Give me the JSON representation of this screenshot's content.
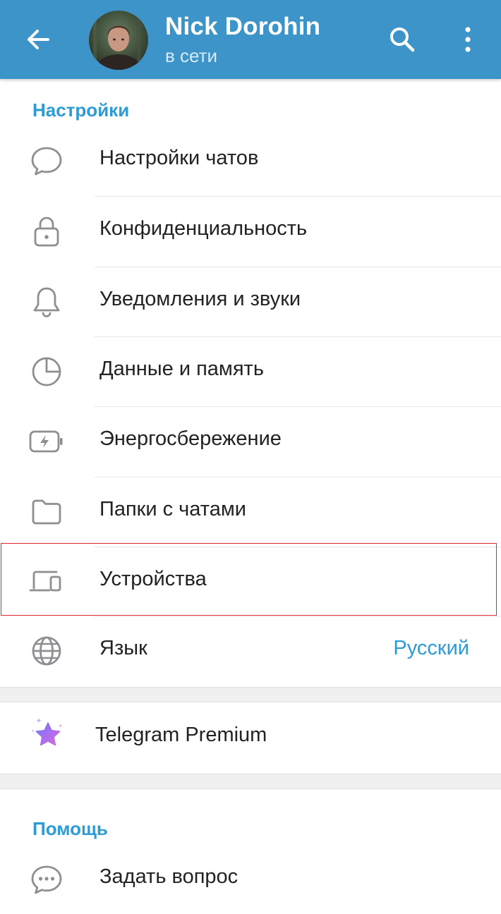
{
  "header": {
    "name": "Nick Dorohin",
    "status": "в сети",
    "icons": [
      "back-arrow-icon",
      "avatar",
      "search-icon",
      "more-vert-icon"
    ]
  },
  "settings_section": {
    "title": "Настройки",
    "items": [
      {
        "label": "Настройки чатов",
        "icon": "chat-bubble-icon"
      },
      {
        "label": "Конфиденциальность",
        "icon": "lock-icon"
      },
      {
        "label": "Уведомления и звуки",
        "icon": "bell-icon"
      },
      {
        "label": "Данные и память",
        "icon": "pie-chart-icon"
      },
      {
        "label": "Энергосбережение",
        "icon": "battery-bolt-icon"
      },
      {
        "label": "Папки с чатами",
        "icon": "folder-icon"
      },
      {
        "label": "Устройства",
        "icon": "devices-icon"
      },
      {
        "label": "Язык",
        "icon": "globe-icon",
        "value": "Русский"
      }
    ]
  },
  "premium": {
    "label": "Telegram Premium",
    "icon": "premium-star-icon"
  },
  "help_section": {
    "title": "Помощь",
    "items": [
      {
        "label": "Задать вопрос",
        "icon": "chat-dots-icon"
      }
    ]
  },
  "colors": {
    "header_bg": "#3d94c8",
    "accent": "#2d9bd6",
    "icon_gray": "#8e8e93",
    "highlight": "#e0262c"
  }
}
